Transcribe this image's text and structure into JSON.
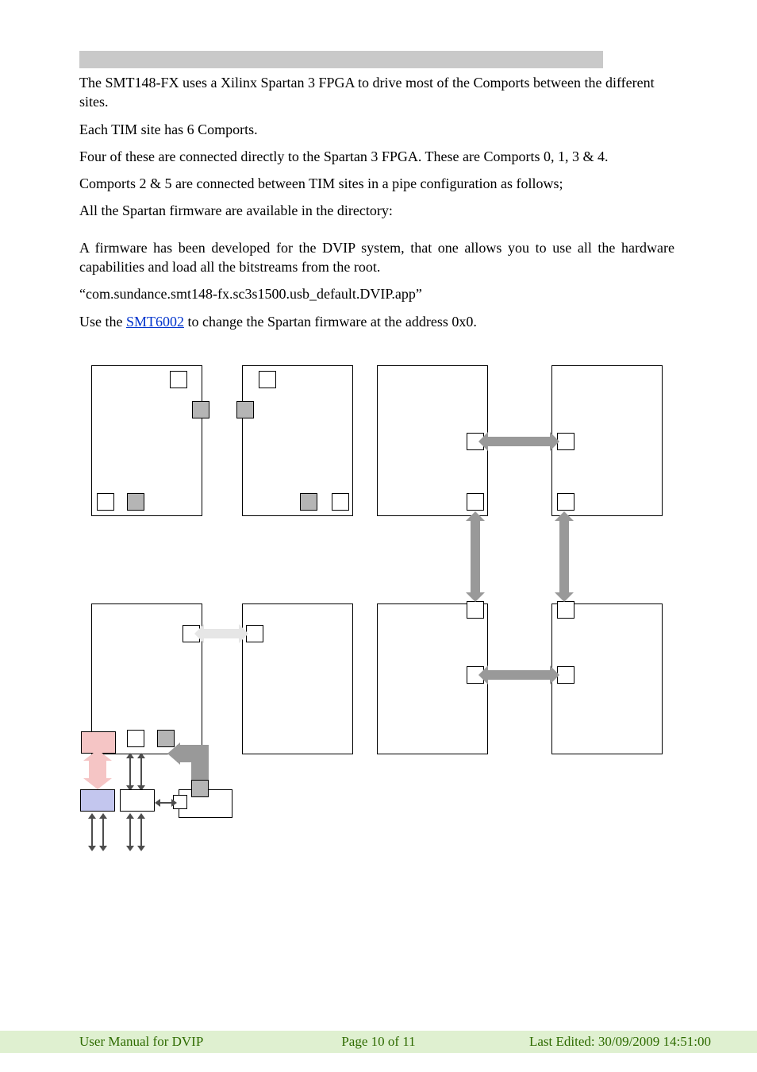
{
  "heading_bar": "",
  "p1": "The SMT148-FX uses a Xilinx Spartan 3 FPGA to drive most of the Comports between the different sites.",
  "p2": "Each TIM site has 6 Comports.",
  "p3": "Four of these are connected directly to the Spartan 3 FPGA. These are Comports 0, 1, 3 & 4.",
  "p4": "Comports 2 & 5 are connected between TIM sites in a pipe configuration as follows;",
  "p5": "All the Spartan firmware are available in the directory:",
  "p6": "A firmware has been developed for the DVIP system, that one allows you to use all the hardware capabilities and load all the bitstreams from the root.",
  "p7": "“com.sundance.smt148-fx.sc3s1500.usb_default.DVIP.app”",
  "p8_pre": "Use the ",
  "p8_link": "SMT6002",
  "p8_post": " to change the Spartan firmware at the address 0x0.",
  "footer": {
    "left": "User Manual for DVIP",
    "center": "Page 10 of 11",
    "right": "Last Edited: 30/09/2009 14:51:00"
  }
}
